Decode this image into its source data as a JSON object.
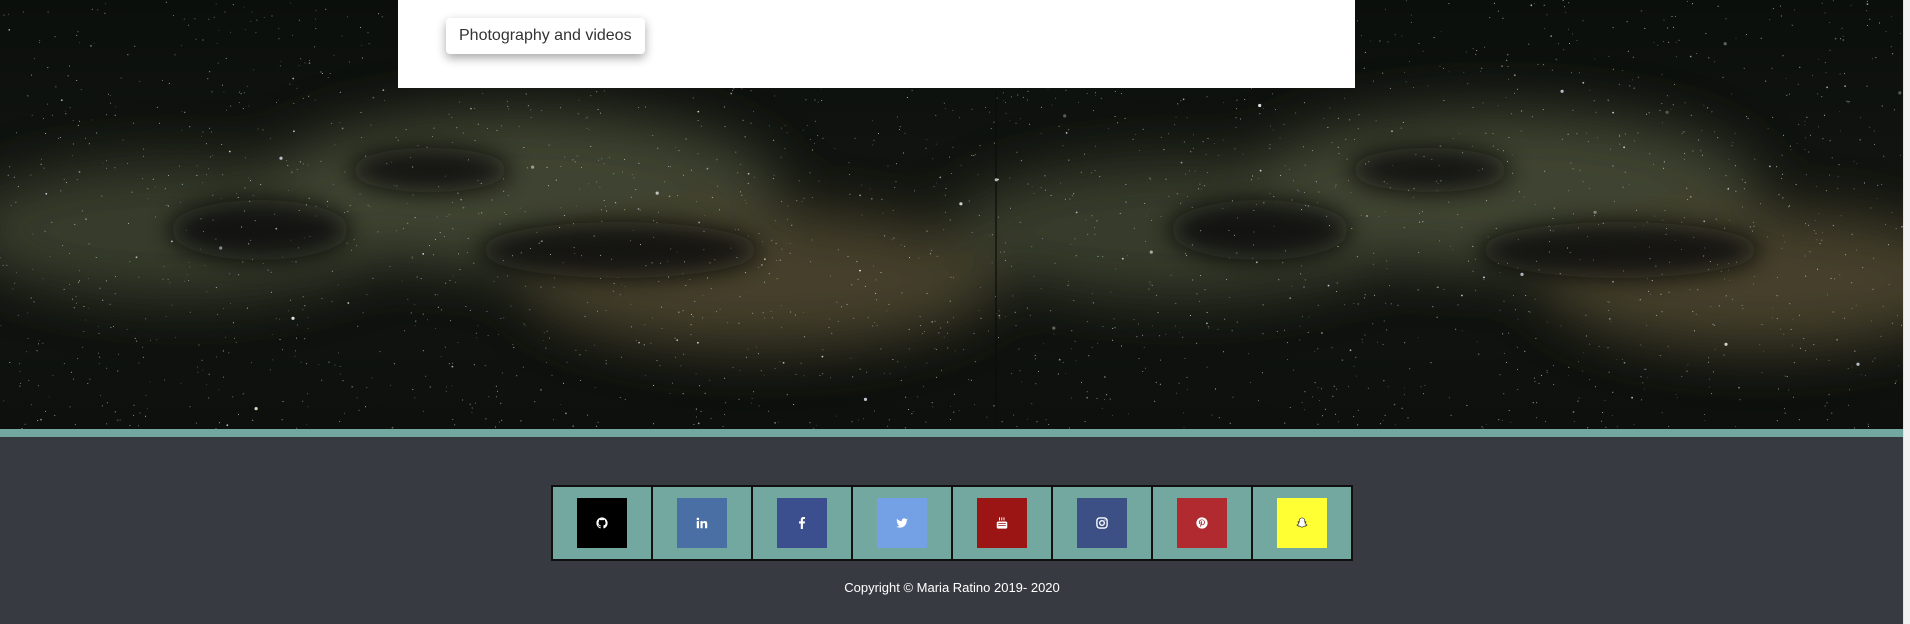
{
  "header": {
    "nav_chip_label": "Photography and videos"
  },
  "hero": {
    "background": "night-sky-milky-way-image"
  },
  "footer": {
    "social_links": [
      {
        "name": "github",
        "icon": "github-icon",
        "color": "#000000"
      },
      {
        "name": "linkedin",
        "icon": "linkedin-icon",
        "color": "#4a6fa5"
      },
      {
        "name": "facebook",
        "icon": "facebook-icon",
        "color": "#3b4f8f"
      },
      {
        "name": "twitter",
        "icon": "twitter-icon",
        "color": "#74a1e6"
      },
      {
        "name": "youtube",
        "icon": "youtube-icon",
        "color": "#9b1515"
      },
      {
        "name": "instagram",
        "icon": "instagram-icon",
        "color": "#3c5086"
      },
      {
        "name": "pinterest",
        "icon": "pinterest-icon",
        "color": "#b02a30"
      },
      {
        "name": "snapchat",
        "icon": "snapchat-icon",
        "color": "#ffff33"
      }
    ],
    "copyright": "Copyright © Maria Ratino 2019- 2020"
  },
  "colors": {
    "footer_bg": "#373a41",
    "accent_teal": "#72a89f",
    "panel_bg": "#ffffff"
  }
}
